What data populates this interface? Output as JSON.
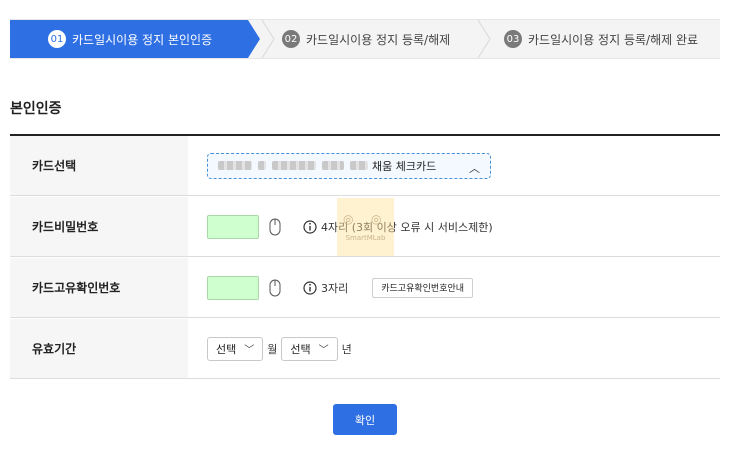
{
  "stepper": {
    "steps": [
      {
        "num": "01",
        "label": "카드일시이용 정지 본인인증"
      },
      {
        "num": "02",
        "label": "카드일시이용 정지 등록/해제"
      },
      {
        "num": "03",
        "label": "카드일시이용 정지 등록/해제 완료"
      }
    ],
    "active_index": 0,
    "active_color": "#2f6fe4"
  },
  "section": {
    "title": "본인인증"
  },
  "form": {
    "card_select": {
      "label": "카드선택",
      "value_suffix": "채움 체크카드"
    },
    "password": {
      "label": "카드비밀번호",
      "hint": "4자리 (3회 이상 오류 시 서비스제한)"
    },
    "cvc": {
      "label": "카드고유확인번호",
      "hint": "3자리",
      "guide_button": "카드고유확인번호안내"
    },
    "expiry": {
      "label": "유효기간",
      "month_select": "선택",
      "month_unit": "월",
      "year_select": "선택",
      "year_unit": "년"
    }
  },
  "confirm_button": "확인",
  "watermark": {
    "text": "SmartMLab"
  },
  "colors": {
    "primary": "#2f6fe4",
    "input_fill": "#cfffcf",
    "label_bg": "#f6f6f6"
  }
}
